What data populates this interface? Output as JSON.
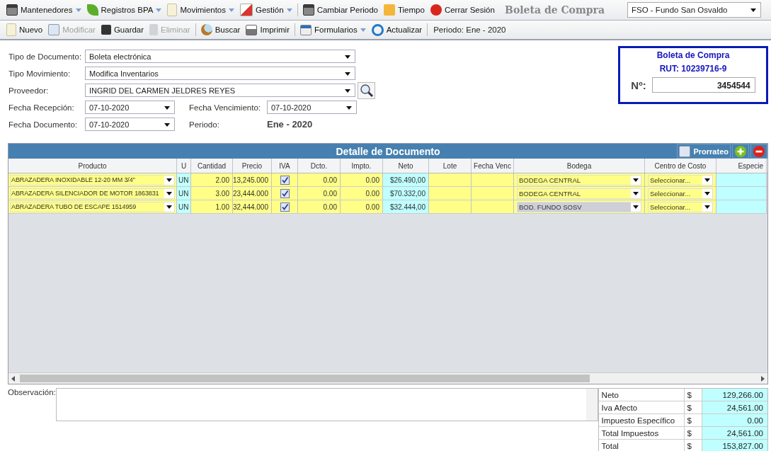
{
  "menu": [
    {
      "label": "Mantenedores",
      "dropdown": true
    },
    {
      "label": "Registros BPA",
      "dropdown": true
    },
    {
      "label": "Movimientos",
      "dropdown": true
    },
    {
      "label": "Gestión",
      "dropdown": true
    },
    {
      "label": "Cambiar Periodo",
      "dropdown": false
    },
    {
      "label": "Tiempo",
      "dropdown": false
    },
    {
      "label": "Cerrar Sesión",
      "dropdown": false
    }
  ],
  "page_title": "Boleta de Compra",
  "company_select": {
    "value": "FSO - Fundo San Osvaldo"
  },
  "toolbar": [
    {
      "label": "Nuevo",
      "disabled": false,
      "dropdown": false
    },
    {
      "label": "Modificar",
      "disabled": true,
      "dropdown": false
    },
    {
      "label": "Guardar",
      "disabled": false,
      "dropdown": false
    },
    {
      "label": "Eliminar",
      "disabled": true,
      "dropdown": false
    },
    {
      "label": "Buscar",
      "disabled": false,
      "dropdown": false
    },
    {
      "label": "Imprimir",
      "disabled": false,
      "dropdown": false
    },
    {
      "label": "Formularios",
      "disabled": false,
      "dropdown": true
    },
    {
      "label": "Actualizar",
      "disabled": false,
      "dropdown": false
    }
  ],
  "period_label": "Periodo: Ene - 2020",
  "form": {
    "tipo_documento": {
      "label": "Tipo de Documento:",
      "value": "Boleta electrónica"
    },
    "tipo_movimiento": {
      "label": "Tipo Movimiento:",
      "value": "Modifica Inventarios"
    },
    "proveedor": {
      "label": "Proveedor:",
      "value": "INGRID DEL CARMEN JELDRES REYES"
    },
    "fecha_recepcion": {
      "label": "Fecha Recepción:",
      "value": "07-10-2020"
    },
    "fecha_vencimiento": {
      "label": "Fecha Vencimiento:",
      "value": "07-10-2020"
    },
    "fecha_documento": {
      "label": "Fecha Documento:",
      "value": "07-10-2020"
    },
    "periodo": {
      "label": "Periodo:",
      "value": "Ene - 2020"
    }
  },
  "doc_box": {
    "title": "Boleta de Compra",
    "rut": "RUT: 10239716-9",
    "number_label": "Nº:",
    "number": "3454544"
  },
  "grid": {
    "title": "Detalle de Documento",
    "prorrateo": "Prorrateo",
    "columns": [
      "Producto",
      "U",
      "Cantidad",
      "Precio",
      "IVA",
      "Dcto.",
      "Impto.",
      "Neto",
      "Lote",
      "Fecha Venc",
      "Bodega",
      "Centro de Costo",
      "Especie"
    ],
    "rows": [
      {
        "producto": "ABRAZADERA INOXIDABLE 12-20 MM 3/4\"",
        "un": "UN",
        "cantidad": "2.00",
        "precio": "13,245.000",
        "iva": true,
        "dcto": "0.00",
        "impto": "0.00",
        "neto": "$26.490,00",
        "bodega": "BODEGA CENTRAL",
        "bodega_disabled": false,
        "centro_costo": "Seleccionar..."
      },
      {
        "producto": "ABRAZADERA SILENCIADOR DE MOTOR 1863831",
        "un": "UN",
        "cantidad": "3.00",
        "precio": "23,444.000",
        "iva": true,
        "dcto": "0.00",
        "impto": "0.00",
        "neto": "$70.332,00",
        "bodega": "BODEGA CENTRAL",
        "bodega_disabled": false,
        "centro_costo": "Seleccionar..."
      },
      {
        "producto": "ABRAZADERA TUBO DE ESCAPE 1514959",
        "un": "UN",
        "cantidad": "1.00",
        "precio": "32,444.000",
        "iva": true,
        "dcto": "0.00",
        "impto": "0.00",
        "neto": "$32.444,00",
        "bodega": "BOD. FUNDO SOSV",
        "bodega_disabled": true,
        "centro_costo": "Seleccionar..."
      }
    ]
  },
  "observacion": {
    "label": "Observación:"
  },
  "totals": [
    {
      "label": "Neto",
      "currency": "$",
      "value": "129,266.00"
    },
    {
      "label": "Iva Afecto",
      "currency": "$",
      "value": "24,561.00"
    },
    {
      "label": "Impuesto Específico",
      "currency": "$",
      "value": "0.00"
    },
    {
      "label": "Total Impuestos",
      "currency": "$",
      "value": "24,561.00"
    },
    {
      "label": "Total",
      "currency": "$",
      "value": "153,827.00"
    }
  ]
}
